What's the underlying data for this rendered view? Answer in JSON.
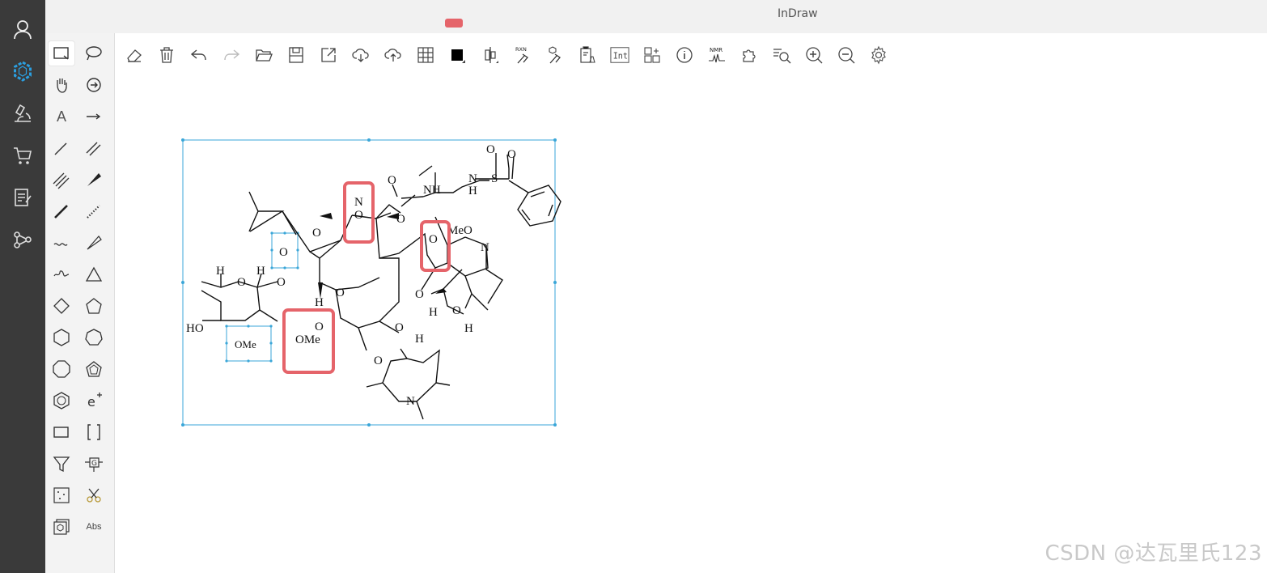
{
  "app": {
    "title": "InDraw"
  },
  "nav": {
    "items": [
      {
        "name": "user-icon"
      },
      {
        "name": "molecule-editor-icon",
        "active": true
      },
      {
        "name": "microscope-icon"
      },
      {
        "name": "shopping-cart-icon"
      },
      {
        "name": "notes-icon"
      },
      {
        "name": "share-icon"
      }
    ],
    "accent_color": "#2b9fe0"
  },
  "palette": {
    "text_tool_label": "A",
    "abs_label": "Abs"
  },
  "toolbar": {
    "rxn_label": "RXN",
    "int_label": "Int",
    "nmr_label": "NMR"
  },
  "molecule": {
    "atoms": {
      "N_top": "N",
      "O_top": "O",
      "O_carbonyl_top": "O",
      "NH": "NH",
      "N_sulf": "N",
      "H_sulf": "H",
      "S": "S",
      "O_s1": "O",
      "O_s2": "O",
      "O_ring1": "O",
      "O_ring2": "O",
      "O_selected": "O",
      "O_epox": "O",
      "MeO": "MeO",
      "N_oxime": "N",
      "H1": "H",
      "H2": "H",
      "O_sugar": "O",
      "O_link": "O",
      "H3": "H",
      "O_lactone": "O",
      "O_right": "O",
      "O_ring3": "O",
      "H4": "H",
      "H5": "H",
      "HO": "HO",
      "OMe_selected": "OMe",
      "OMe_mid": "OMe",
      "O_keto": "O",
      "O_glyc": "O",
      "H6": "H",
      "O_az": "O",
      "N_az": "N"
    }
  },
  "watermark": "CSDN @达瓦里氏123",
  "colors": {
    "highlight": "#e5646a",
    "selection": "#3aa6d8"
  }
}
